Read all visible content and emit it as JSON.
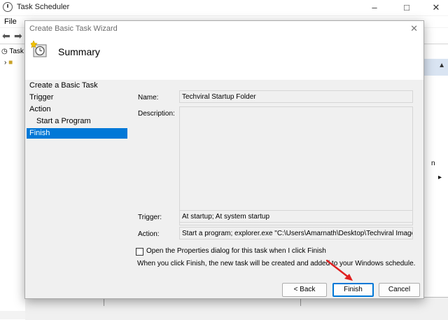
{
  "app": {
    "title": "Task Scheduler",
    "menu": [
      "File"
    ],
    "tree": [
      "Task"
    ],
    "right_pane": {
      "fragment_1": "n"
    }
  },
  "dialog": {
    "title": "Create Basic Task Wizard",
    "heading": "Summary",
    "steps": [
      {
        "label": "Create a Basic Task",
        "active": false,
        "indent": false
      },
      {
        "label": "Trigger",
        "active": false,
        "indent": false
      },
      {
        "label": "Action",
        "active": false,
        "indent": false
      },
      {
        "label": "Start a Program",
        "active": false,
        "indent": true
      },
      {
        "label": "Finish",
        "active": true,
        "indent": false
      }
    ],
    "fields": {
      "name_label": "Name:",
      "name_value": "Techviral Startup Folder",
      "description_label": "Description:",
      "description_value": "",
      "trigger_label": "Trigger:",
      "trigger_value": "At startup; At system startup",
      "action_label": "Action:",
      "action_value": "Start a program; explorer.exe \"C:\\Users\\Amarnath\\Desktop\\Techviral Images\""
    },
    "checkbox_label": "Open the Properties dialog for this task when I click Finish",
    "checkbox_checked": false,
    "note": "When you click Finish, the new task will be created and added to your Windows schedule.",
    "buttons": {
      "back": "< Back",
      "finish": "Finish",
      "cancel": "Cancel"
    }
  },
  "colors": {
    "accent": "#0078d7",
    "arrow": "#e02020"
  }
}
